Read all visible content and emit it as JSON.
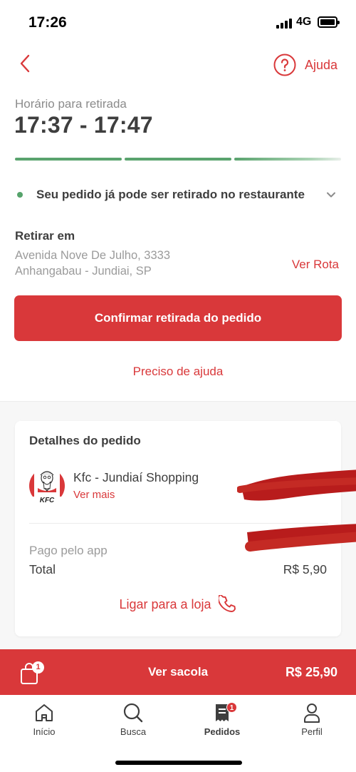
{
  "status_bar": {
    "time": "17:26",
    "network": "4G"
  },
  "header": {
    "help_label": "Ajuda"
  },
  "pickup": {
    "label": "Horário para retirada",
    "time_range": "17:37 - 17:47",
    "progress": [
      1.0,
      1.0,
      1.0
    ],
    "status_text": "Seu pedido já pode ser retirado no restaurante"
  },
  "retrieve": {
    "title": "Retirar em",
    "address_line1": "Avenida Nove De Julho, 3333",
    "address_line2": "Anhangabau - Jundiai, SP",
    "route_label": "Ver Rota"
  },
  "actions": {
    "confirm_label": "Confirmar retirada do pedido",
    "help_label": "Preciso de ajuda"
  },
  "order_details": {
    "title": "Detalhes do pedido",
    "store_name": "Kfc - Jundiaí Shopping",
    "store_logo_text": "KFC",
    "see_more_label": "Ver mais",
    "paid_label": "Pago pelo app",
    "total_label": "Total",
    "total_value": "R$ 5,90",
    "call_label": "Ligar para a loja"
  },
  "bag": {
    "badge": "1",
    "label": "Ver sacola",
    "total": "R$ 25,90"
  },
  "tabs": [
    {
      "label": "Início",
      "icon": "home-icon"
    },
    {
      "label": "Busca",
      "icon": "search-icon"
    },
    {
      "label": "Pedidos",
      "icon": "orders-icon",
      "badge": "1",
      "active": true
    },
    {
      "label": "Perfil",
      "icon": "profile-icon"
    }
  ],
  "colors": {
    "accent": "#d9383a",
    "success": "#5aa36e",
    "text": "#3e3e3e",
    "muted": "#9b9b9b"
  }
}
